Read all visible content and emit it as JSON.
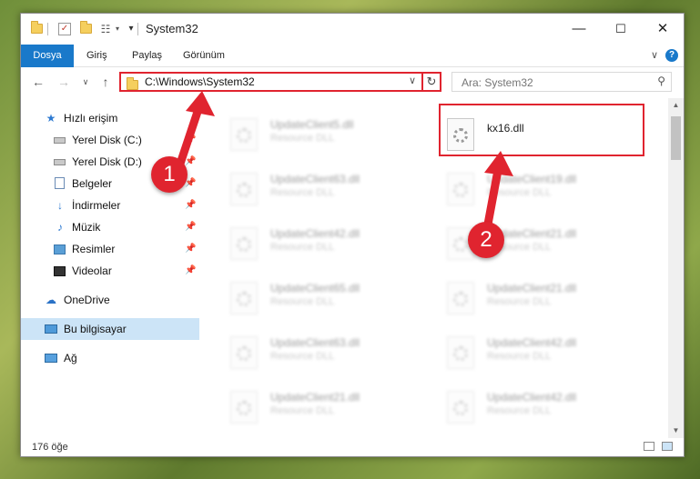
{
  "window": {
    "title": "System32",
    "controls": {
      "minimize": "—",
      "maximize": "☐",
      "close": "✕"
    }
  },
  "ribbon": {
    "tabs": [
      {
        "label": "Dosya"
      },
      {
        "label": "Giriş"
      },
      {
        "label": "Paylaş"
      },
      {
        "label": "Görünüm"
      }
    ],
    "help": "?"
  },
  "address": {
    "path": "C:\\Windows\\System32",
    "search_placeholder": "Ara: System32"
  },
  "nav_pane": {
    "items": [
      {
        "label": "Hızlı erişim"
      },
      {
        "label": "Yerel Disk (C:)"
      },
      {
        "label": "Yerel Disk (D:)"
      },
      {
        "label": "Belgeler"
      },
      {
        "label": "İndirmeler"
      },
      {
        "label": "Müzik"
      },
      {
        "label": "Resimler"
      },
      {
        "label": "Videolar"
      },
      {
        "label": "OneDrive"
      },
      {
        "label": "Bu bilgisayar"
      },
      {
        "label": "Ağ"
      }
    ]
  },
  "files": [
    {
      "name": "UpdateClient5.dll",
      "type": "Resource DLL"
    },
    {
      "name": "kx16.dll",
      "type": ""
    },
    {
      "name": "UpdateClient63.dll",
      "type": "Resource DLL"
    },
    {
      "name": "UpdateClient19.dll",
      "type": "Resource DLL"
    },
    {
      "name": "UpdateClient42.dll",
      "type": "Resource DLL"
    },
    {
      "name": "UpdateClient21.dll",
      "type": "Resource DLL"
    },
    {
      "name": "UpdateClient65.dll",
      "type": "Resource DLL"
    },
    {
      "name": "UpdateClient21.dll",
      "type": "Resource DLL"
    },
    {
      "name": "UpdateClient63.dll",
      "type": "Resource DLL"
    },
    {
      "name": "UpdateClient42.dll",
      "type": "Resource DLL"
    },
    {
      "name": "UpdateClient21.dll",
      "type": "Resource DLL"
    },
    {
      "name": "UpdateClient42.dll",
      "type": "Resource DLL"
    }
  ],
  "status": {
    "item_count": "176 öğe"
  },
  "annotations": {
    "step1": "1",
    "step2": "2",
    "color": "#e0242f"
  },
  "colors": {
    "accent": "#1979ca",
    "selection": "#cce4f7"
  }
}
